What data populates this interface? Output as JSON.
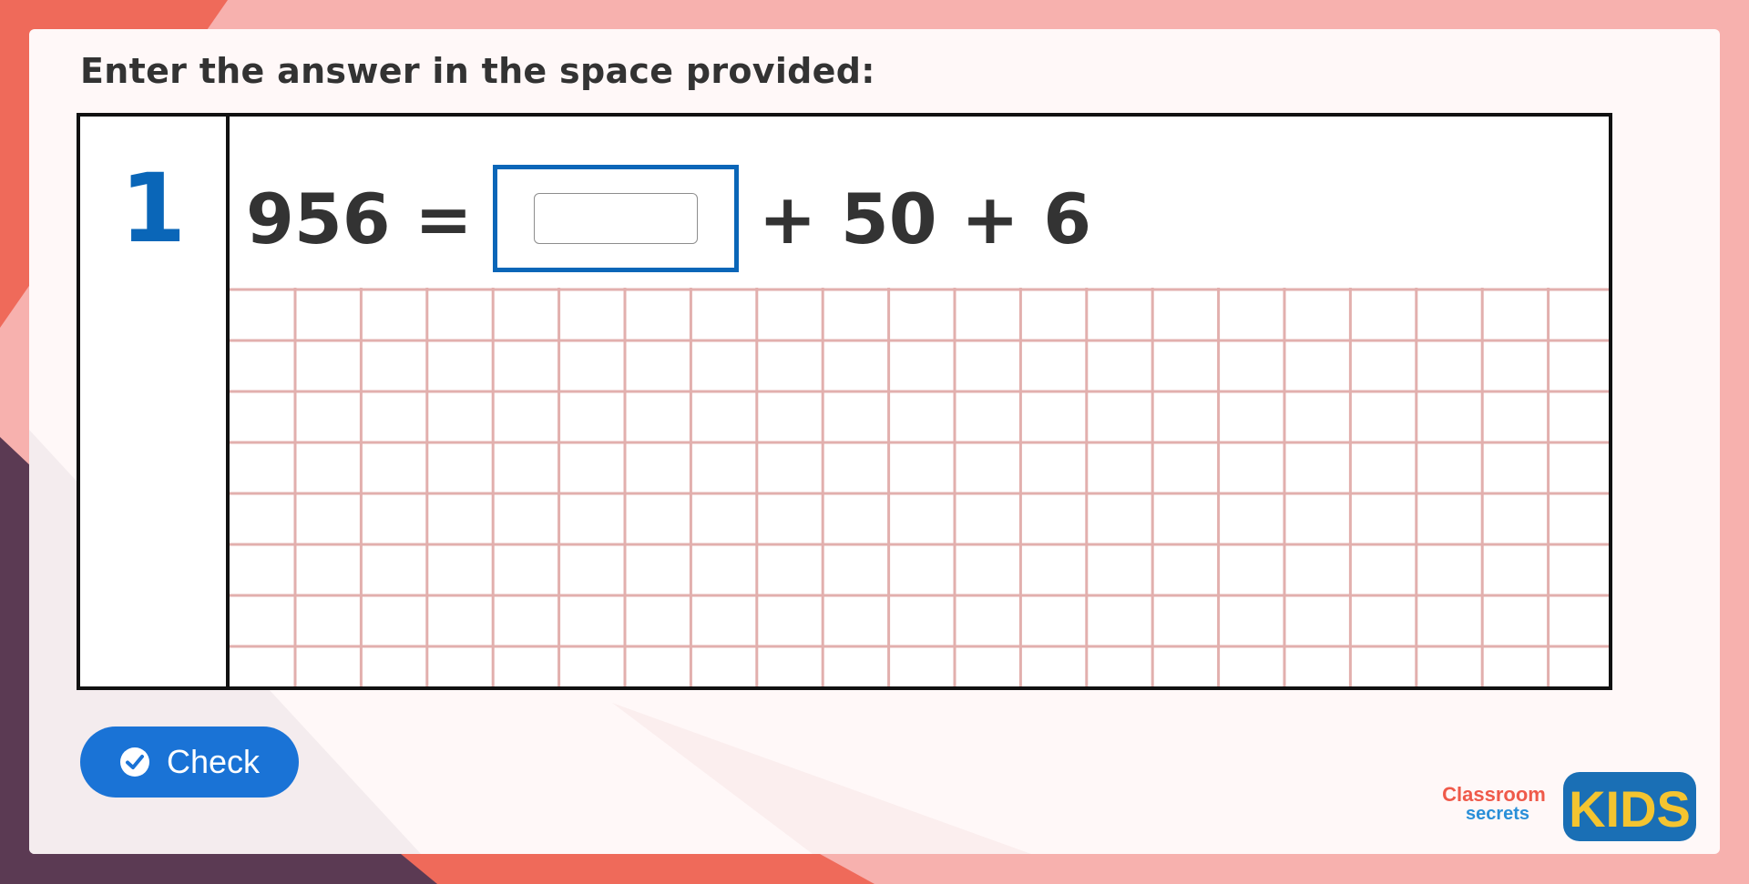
{
  "instruction": "Enter the answer in the space provided:",
  "question": {
    "number": "1",
    "lhs": "956 =",
    "answer_value": "",
    "rhs": "+ 50 + 6"
  },
  "check_button": {
    "label": "Check",
    "icon": "check-circle-icon"
  },
  "logo": {
    "brand_line1": "Classroom",
    "brand_line2": "secrets",
    "kids": "KIDS"
  },
  "colors": {
    "accent_blue": "#0a66b8",
    "button_blue": "#1a73d6",
    "grid_line": "#e2afad",
    "bg_pink": "#f7b1ae",
    "bg_coral": "#ef6a5a",
    "bg_purple": "#5b3a53"
  }
}
